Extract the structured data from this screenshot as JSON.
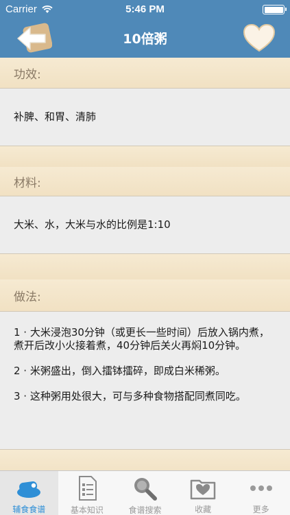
{
  "status_bar": {
    "carrier": "Carrier",
    "time": "5:46 PM",
    "icons": [
      "wifi-icon",
      "battery-icon"
    ]
  },
  "nav": {
    "title": "10倍粥",
    "back_icon": "back-arrow-icon",
    "favorite_icon": "heart-icon"
  },
  "sections": {
    "efficacy": {
      "heading": "功效:",
      "text": "补脾、和胃、清肺"
    },
    "ingredients": {
      "heading": "材料:",
      "text": "大米、水，大米与水的比例是1:10"
    },
    "method": {
      "heading": "做法:",
      "steps": [
        "1 · 大米浸泡30分钟（或更长一些时间）后放入锅内煮，煮开后改小火接着煮，40分钟后关火再焖10分钟。",
        "2 · 米粥盛出，倒入擂钵擂碎，即成白米稀粥。",
        "3 · 这种粥用处很大，可与多种食物搭配同煮同吃。"
      ]
    }
  },
  "tabbar": {
    "tabs": [
      {
        "label": "辅食食谱",
        "icon": "food-tray-icon",
        "active": true
      },
      {
        "label": "基本知识",
        "icon": "document-icon",
        "active": false
      },
      {
        "label": "食谱搜索",
        "icon": "magnifier-icon",
        "active": false
      },
      {
        "label": "收藏",
        "icon": "heart-folder-icon",
        "active": false
      },
      {
        "label": "更多",
        "icon": "more-dots-icon",
        "active": false
      }
    ]
  },
  "colors": {
    "nav_blue": "#4f89b8",
    "paper": "#f3e6cc",
    "card": "#ededed",
    "tab_active": "#2f8fd6"
  }
}
